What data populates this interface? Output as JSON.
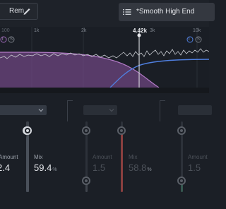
{
  "toolbar": {
    "left_label": "Rem",
    "preset_name": "*Smooth High End"
  },
  "spectrum": {
    "freq_labels": [
      "100",
      "1k",
      "2k",
      "3k",
      "10k"
    ],
    "active_freq": "4.42k",
    "band_markers": [
      "I",
      "S",
      "I",
      "S"
    ]
  },
  "panels": [
    {
      "mode": "",
      "params": [
        {
          "label": "Amount",
          "value": "2.4",
          "unit": ""
        },
        {
          "label": "Mix",
          "value": "59.4",
          "unit": "%"
        }
      ]
    },
    {
      "mode": "",
      "params": [
        {
          "label": "Amount",
          "value": "1.5",
          "unit": ""
        },
        {
          "label": "Mix",
          "value": "58.8",
          "unit": "%"
        }
      ]
    },
    {
      "mode": "",
      "params": [
        {
          "label": "Amount",
          "value": "1.5",
          "unit": ""
        }
      ]
    }
  ],
  "colors": {
    "purple_band": "#9b5fb0",
    "blue_band": "#4f7fe0",
    "mix_blue": "#4a86e8",
    "mix_red": "#c45a5a",
    "amount_teal": "#4f8f80"
  },
  "slider_levels": {
    "panel1_amount": 0.72,
    "panel1_mix": 0.59,
    "panel2_amount": 0.15,
    "panel2_mix": 0.59,
    "panel3_amount": 0.15
  }
}
